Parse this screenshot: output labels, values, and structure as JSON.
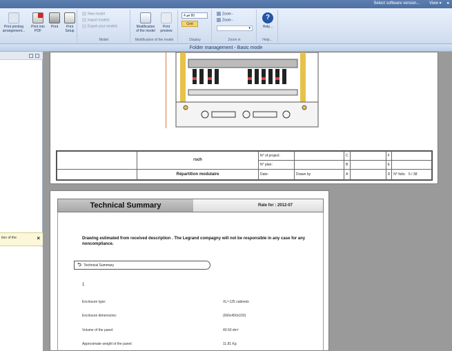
{
  "topbar": {
    "select_software_version": "Select software version...",
    "view": "View"
  },
  "ribbon": {
    "groups": [
      {
        "label": ""
      },
      {
        "label": "Model"
      },
      {
        "label": "Modification of the model"
      },
      {
        "label": "Display"
      },
      {
        "label": "Zoom in"
      },
      {
        "label": "Help..."
      }
    ],
    "buttons": {
      "print_existing": "Print printing arrangement...",
      "print_pdf": "Print into PDF",
      "print": "Print",
      "print_setup": "Print Setup",
      "modification": "Modification of the model",
      "print_preview": "Print preview",
      "help": "Help..."
    },
    "model_items": [
      "New model",
      "Import models",
      "Export your models"
    ],
    "zoom_value": "4",
    "zoom_unit": "80",
    "grid_label": "Grid",
    "zoom_plus": "Zoom -",
    "zoom_minus": "Zoom -"
  },
  "folder_title": "Folder management - Basic mode",
  "left_panel": {
    "tab_label": "tion of the"
  },
  "drawing": {
    "title_block": {
      "name": "rsch",
      "subtitle": "Répartition modulaire",
      "project_label": "N° of project:",
      "plan_label": "N° plan:",
      "date_label": "Date:",
      "drawn_by_label": "Drawn by",
      "folio_label": "N° folio:",
      "folio_value": "5 / 38",
      "rev": [
        "C",
        "B",
        "A"
      ],
      "rev2": [
        "F",
        "E",
        "D"
      ]
    }
  },
  "summary": {
    "title": "Technical Summary",
    "date_label": "Rate for : 2012-07",
    "disclaimer": "Drawing estimated from received description . The Legrand compagny will not be responsible in any case for any noncompliance.",
    "section_label": "Technical Summary",
    "section_number": "1",
    "properties": [
      {
        "label": "Enclosure type:",
        "value": "XL³-125 cabinets"
      },
      {
        "label": "Enclosure dimensions:",
        "value": "(660x450x150)"
      },
      {
        "label": "Volume of the panel:",
        "value": "40.50 dm³"
      },
      {
        "label": "Approximate weight of the panel:",
        "value": "11.81 Kg"
      }
    ]
  }
}
